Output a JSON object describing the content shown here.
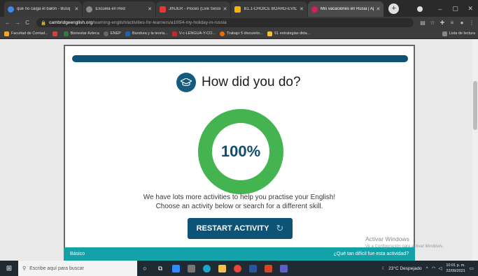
{
  "tabs": [
    {
      "label": "que no caiga el balón - Búsq",
      "color": "#4285f4",
      "active": false
    },
    {
      "label": "Escuela en Red",
      "color": "#8a8a8a",
      "active": false
    },
    {
      "label": "JINJER - Pisces (Live Session)",
      "color": "#e53935",
      "active": false
    },
    {
      "label": "B1.1-CHOICE BOARD-EVIDEN",
      "color": "#f5b400",
      "active": false
    },
    {
      "label": "Mis vacaciones en Rusia | Ap",
      "color": "#d81b60",
      "active": true
    }
  ],
  "newtab_label": "+",
  "window_controls": [
    "–",
    "▢",
    "✕"
  ],
  "address": {
    "domain": "cambridgeenglish.org",
    "path": "/learning-english/activities-for-learners/a1l054-my-holiday-in-russia"
  },
  "bookmarks": [
    {
      "label": "Facultad de Contad...",
      "color": "#f5a623"
    },
    {
      "label": "",
      "color": "#e53935"
    },
    {
      "label": "Bienestar Azteca",
      "color": "#2e7d32"
    },
    {
      "label": "ENEP",
      "color": "#666"
    },
    {
      "label": "Bandura y la teoría...",
      "color": "#1565c0"
    },
    {
      "label": "V-c-LENGUA-Y-CO...",
      "color": "#c62828"
    },
    {
      "label": "Trabajo 5 discusión...",
      "color": "#ef6c00"
    },
    {
      "label": "61 estrategias dida...",
      "color": "#fbc02d"
    }
  ],
  "reading_list": "Lista de lectura",
  "result": {
    "title": "How did you do?",
    "score": "100%",
    "score_fraction": 1.0,
    "message_line1": "We have lots more activities to help you practise your English!",
    "message_line2": "Choose an activity below or search for a different skill.",
    "restart_label": "RESTART ACTIVITY"
  },
  "footer_strip": {
    "level": "Básico",
    "question": "¿Qué tan difícil fue esta actividad?"
  },
  "watermark": {
    "line1": "Activar Windows",
    "line2": "Ve a Configuración para activar Windows."
  },
  "taskbar": {
    "search_placeholder": "Escribe aquí para buscar",
    "weather": "23°C  Despejado",
    "time": "10:01 p. m.",
    "date": "22/09/2021"
  },
  "colors": {
    "accent": "#0e5276",
    "donut": "#43b44f",
    "strip": "#12a2a8"
  }
}
